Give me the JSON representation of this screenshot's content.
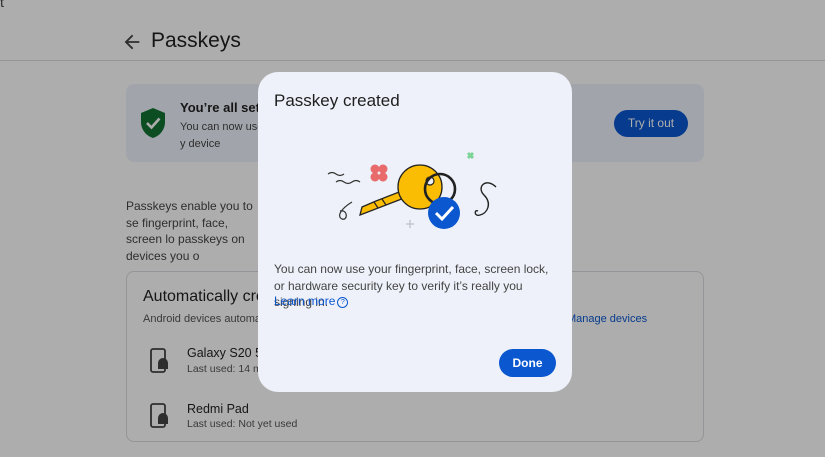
{
  "page": {
    "topedge_text": "t",
    "title": "Passkeys",
    "banner": {
      "title": "You’re all set!",
      "text": "You can now use y device",
      "try_button": "Try it out"
    },
    "intro": "Passkeys enable you to se fingerprint, face, screen lo passkeys on devices you o",
    "auto_section": {
      "title": "Automatically cre",
      "subtitle": "Android devices automatic",
      "manage_link": "Manage devices",
      "devices": [
        {
          "name": "Galaxy S20 5G",
          "used": "Last used: 14 mi"
        },
        {
          "name": "Redmi Pad",
          "used": "Last used: Not yet used"
        }
      ]
    }
  },
  "dialog": {
    "title": "Passkey created",
    "body": "You can now use your fingerprint, face, screen lock, or hardware security key to verify it’s really you signing in.",
    "learn_more": "Learn more",
    "help_glyph": "?",
    "done_button": "Done"
  },
  "colors": {
    "accent": "#0b57d0",
    "shield": "#137333",
    "key": "#fbbc04",
    "scrim": "rgba(0,0,0,0.32)",
    "dialog_bg": "#eef1f9"
  }
}
